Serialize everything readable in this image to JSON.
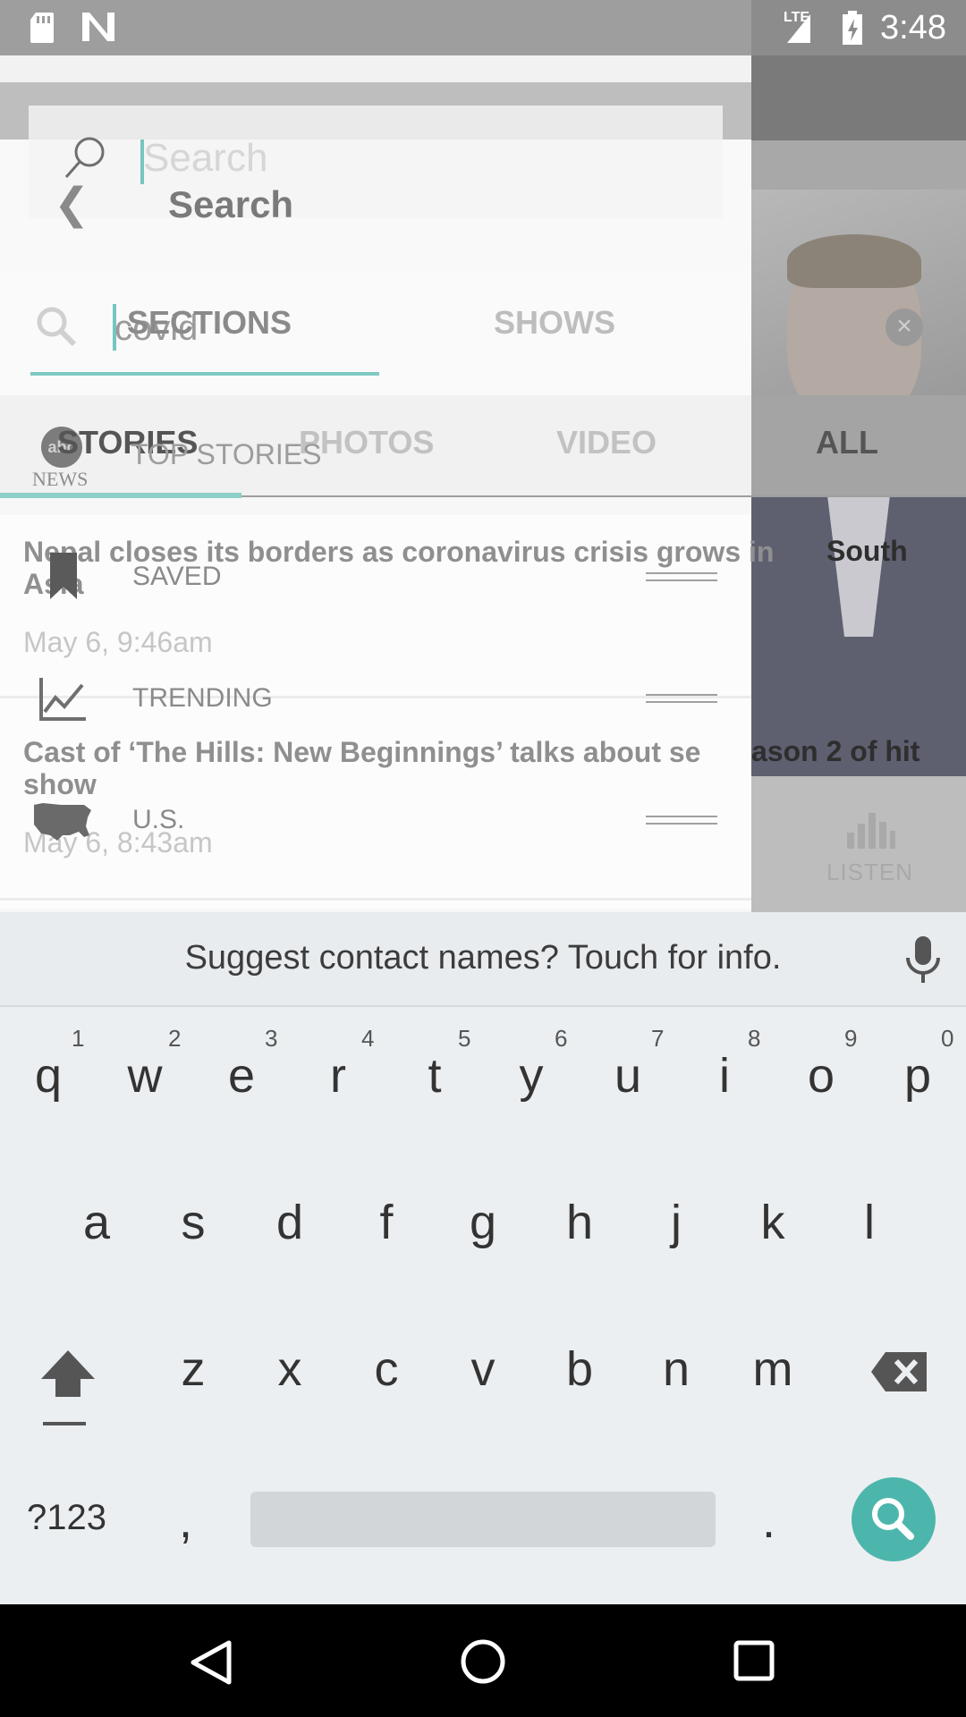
{
  "status_bar": {
    "time": "3:48",
    "network": "LTE",
    "icons": [
      "sd-card-icon",
      "n-notification-icon",
      "signal-icon",
      "battery-charging-icon"
    ]
  },
  "search_header": {
    "input_placeholder": "Search",
    "title": "Search",
    "back_icon": "back-chevron-icon"
  },
  "search_field": {
    "value": "covid"
  },
  "section_tabs": {
    "sections": "SECTIONS",
    "shows": "SHOWS"
  },
  "result_tabs": {
    "stories": "STORIES",
    "photos": "PHOTOS",
    "video": "VIDEO",
    "all": "ALL"
  },
  "brand": {
    "logo_text": "abc",
    "news_label": "NEWS"
  },
  "menu": {
    "top_stories": "TOP STORIES",
    "saved": "SAVED",
    "trending": "TRENDING",
    "us": "U.S."
  },
  "results": [
    {
      "headline_left": "Nepal closes its borders as coronavirus crisis grows in",
      "headline_right": "South",
      "headline_line2": "Asia",
      "date": "May 6, 9:46am"
    },
    {
      "headline_left": "Cast of ‘The Hills: New Beginnings’ talks about se",
      "headline_right": "ason 2 of hit",
      "headline_line2": "show",
      "date": "May 6, 8:43am"
    }
  ],
  "under_screen": {
    "listen_label": "LISTEN"
  },
  "keyboard": {
    "suggestion": "Suggest contact names? Touch for info.",
    "row1": [
      "q",
      "w",
      "e",
      "r",
      "t",
      "y",
      "u",
      "i",
      "o",
      "p"
    ],
    "row1_numbers": [
      "1",
      "2",
      "3",
      "4",
      "5",
      "6",
      "7",
      "8",
      "9",
      "0"
    ],
    "row2": [
      "a",
      "s",
      "d",
      "f",
      "g",
      "h",
      "j",
      "k",
      "l"
    ],
    "row3": [
      "z",
      "x",
      "c",
      "v",
      "b",
      "n",
      "m"
    ],
    "sym_key": "?123",
    "comma": ",",
    "period": ".",
    "accent_color": "#4db6ac"
  }
}
